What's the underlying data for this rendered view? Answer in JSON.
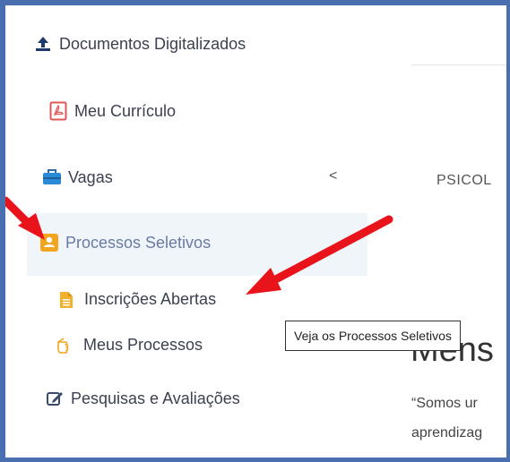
{
  "sidebar": {
    "items": [
      {
        "label": "Documentos Digitalizados",
        "icon": "upload-icon"
      },
      {
        "label": "Meu Currículo",
        "icon": "pdf-icon"
      },
      {
        "label": "Vagas",
        "icon": "briefcase-icon",
        "chevron": "<"
      },
      {
        "label": "Processos Seletivos",
        "icon": "id-card-icon"
      },
      {
        "label": "Pesquisas e Avaliações",
        "icon": "edit-icon"
      }
    ],
    "subitems": [
      {
        "label": "Inscrições Abertas",
        "icon": "document-icon"
      },
      {
        "label": "Meus Processos",
        "icon": "hand-pointer-icon"
      }
    ]
  },
  "main": {
    "top_label": "PSICOL",
    "heading": "Mens",
    "quote_lines": [
      "“Somos ur",
      "aprendizag"
    ]
  },
  "tooltip": {
    "text": "Veja os Processos Seletivos"
  },
  "colors": {
    "frame_border": "#4a6fb0",
    "active_background": "#f0f5f9",
    "active_text": "#6a7aa6",
    "accent_orange": "#f2a61f",
    "annotation_arrow": "#e8131b"
  }
}
